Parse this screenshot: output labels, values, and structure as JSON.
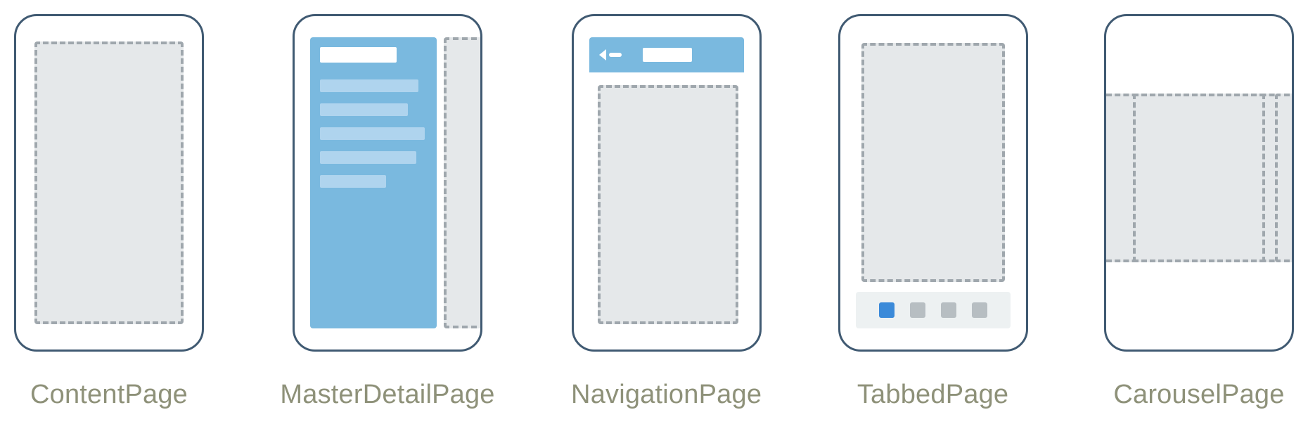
{
  "page_types": [
    {
      "key": "content",
      "label": "ContentPage"
    },
    {
      "key": "masterdetail",
      "label": "MasterDetailPage"
    },
    {
      "key": "navigation",
      "label": "NavigationPage"
    },
    {
      "key": "tabbed",
      "label": "TabbedPage"
    },
    {
      "key": "carousel",
      "label": "CarouselPage"
    }
  ],
  "colors": {
    "outline": "#405a72",
    "accent": "#7ab9df",
    "accent_light": "#afd4ee",
    "accent_dot": "#3b8ad9",
    "placeholder_fill": "#e5e8ea",
    "placeholder_dash": "#9fa7ad",
    "label_text": "#8e9179"
  },
  "diagram": {
    "tabbed_page_tab_count": 4,
    "tabbed_page_active_index": 0,
    "masterdetail_menu_item_count": 5
  }
}
